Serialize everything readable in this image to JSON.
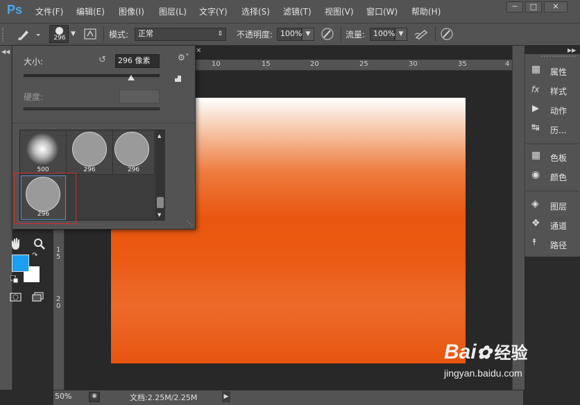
{
  "app": {
    "logo": "Ps"
  },
  "menu": [
    "文件(F)",
    "编辑(E)",
    "图像(I)",
    "图层(L)",
    "文字(Y)",
    "选择(S)",
    "滤镜(T)",
    "视图(V)",
    "窗口(W)",
    "帮助(H)"
  ],
  "window_controls": [
    "minimize",
    "restore",
    "close"
  ],
  "options": {
    "brush_size_badge": "296",
    "mode_label": "模式:",
    "mode_value": "正常",
    "opacity_label": "不透明度:",
    "opacity_value": "100%",
    "flow_label": "流量:",
    "flow_value": "100%"
  },
  "brush_panel": {
    "size_label": "大小:",
    "size_value": "296 像素",
    "size_slider_fraction": 0.8,
    "hardness_label": "硬度:",
    "presets": [
      {
        "size": "500",
        "type": "soft"
      },
      {
        "size": "296",
        "type": "hard"
      },
      {
        "size": "296",
        "type": "hard"
      },
      {
        "size": "296",
        "type": "hard",
        "selected": true
      }
    ]
  },
  "ruler": {
    "top": [
      "10",
      "15",
      "20",
      "25",
      "30",
      "35",
      "4"
    ],
    "left": [
      "1",
      "5",
      "2",
      "0"
    ]
  },
  "tools": {
    "foreground_color": "#1b9ff0",
    "background_color": "#ffffff"
  },
  "right_panel": {
    "group1": [
      {
        "label": "属性",
        "icon": "properties-icon"
      },
      {
        "label": "样式",
        "icon": "styles-fx-icon"
      },
      {
        "label": "动作",
        "icon": "actions-play-icon"
      },
      {
        "label": "历...",
        "icon": "history-icon"
      }
    ],
    "group2": [
      {
        "label": "色板",
        "icon": "swatches-icon"
      },
      {
        "label": "颜色",
        "icon": "color-palette-icon"
      }
    ],
    "group3": [
      {
        "label": "图层",
        "icon": "layers-icon"
      },
      {
        "label": "通道",
        "icon": "channels-icon"
      },
      {
        "label": "路径",
        "icon": "paths-icon"
      }
    ]
  },
  "status": {
    "zoom": "50%",
    "doc_info": "文档:2.25M/2.25M"
  },
  "watermark": {
    "brand_en": "Bai",
    "brand_cn": "经验",
    "url": "jingyan.baidu.com"
  }
}
